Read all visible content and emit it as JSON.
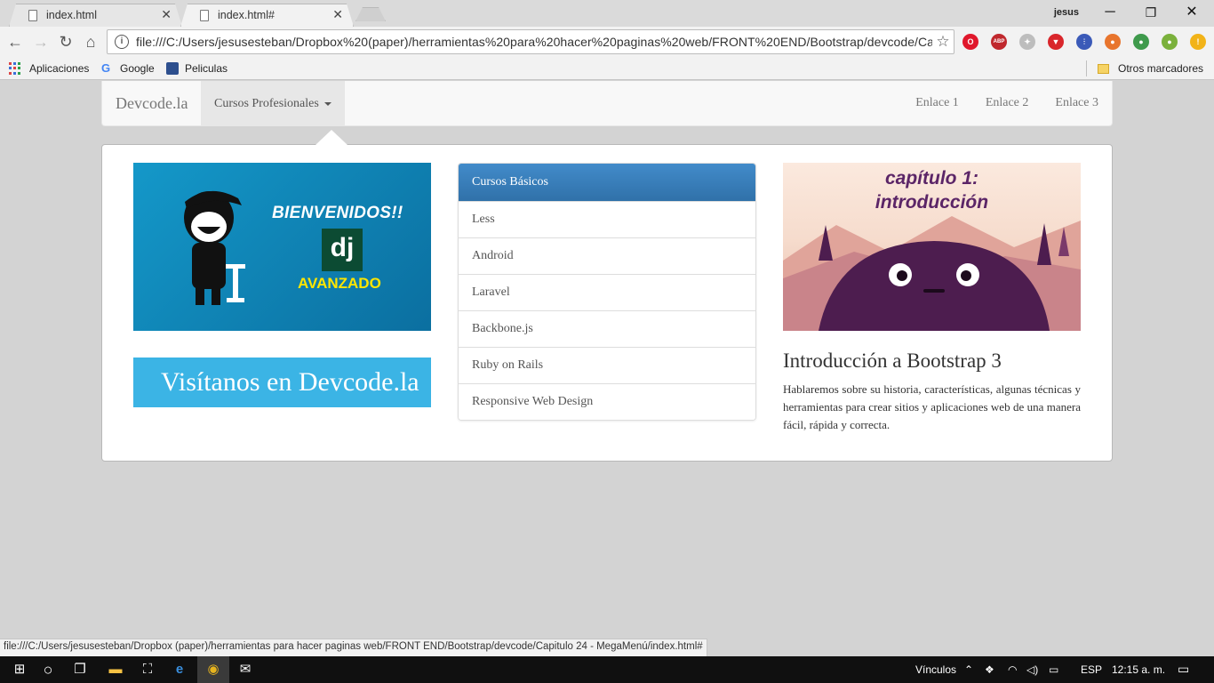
{
  "browser": {
    "tabs": [
      {
        "label": "index.html"
      },
      {
        "label": "index.html#"
      }
    ],
    "close_glyph": "✕",
    "user": "jesus",
    "window_controls": {
      "minimize": "─",
      "maximize": "❐",
      "close": "✕"
    },
    "nav": {
      "back": "←",
      "forward": "→",
      "reload": "↻",
      "home": "⌂"
    },
    "address": "file:///C:/Users/jesusesteban/Dropbox%20(paper)/herramientas%20para%20hacer%20paginas%20web/FRONT%20END/Bootstrap/devcode/Ca...",
    "star": "☆",
    "extensions": [
      {
        "icon": "opera-icon",
        "glyph": "O",
        "color": "#e0172b"
      },
      {
        "icon": "adblock-plus-icon",
        "glyph": "ABP",
        "color": "#c0282d"
      },
      {
        "icon": "puzzle-icon",
        "glyph": "✦",
        "color": "#bdbdbd"
      },
      {
        "icon": "shield-icon",
        "glyph": "▼",
        "color": "#d9262b"
      },
      {
        "icon": "equalizer-icon",
        "glyph": "⫶",
        "color": "#3b5ab8"
      },
      {
        "icon": "firefox-icon",
        "glyph": "●",
        "color": "#e8752d"
      },
      {
        "icon": "globe-icon",
        "glyph": "●",
        "color": "#3f9a4c"
      },
      {
        "icon": "chrome-color-icon",
        "glyph": "●",
        "color": "#7bb13c"
      },
      {
        "icon": "info-icon",
        "glyph": "!",
        "color": "#f2b318"
      }
    ],
    "menu_glyph": "⋮",
    "bookmarks": {
      "apps": "Aplicaciones",
      "google": "Google",
      "movies": "Peliculas",
      "other": "Otros marcadores"
    }
  },
  "page": {
    "brand": "Devcode.la",
    "dropdown_label": "Cursos Profesionales",
    "nav_links": [
      "Enlace 1",
      "Enlace 2",
      "Enlace 3"
    ],
    "banner_left": {
      "heading": "BIENVENIDOS!!",
      "logo": "dj",
      "subheading": "AVANZADO"
    },
    "visit_label": "Visítanos en Devcode.la",
    "courses": {
      "header": "Cursos Básicos",
      "items": [
        "Less",
        "Android",
        "Laravel",
        "Backbone.js",
        "Ruby on Rails",
        "Responsive Web Design"
      ]
    },
    "banner_right": {
      "line1": "capítulo 1:",
      "line2": "introducción"
    },
    "article": {
      "title": "Introducción a Bootstrap 3",
      "body": "Hablaremos sobre su historia, características, algunas técnicas y herramientas para crear sitios y aplicaciones web de una manera fácil, rápida y correcta."
    }
  },
  "status_url": "file:///C:/Users/jesusesteban/Dropbox (paper)/herramientas para hacer paginas web/FRONT END/Bootstrap/devcode/Capitulo 24 - MegaMenú/index.html#",
  "taskbar": {
    "links_label": "Vínculos",
    "language": "ESP",
    "clock": "12:15 a. m."
  },
  "colors": {
    "page_bg": "#d3d3d3",
    "list_header": "#428bca",
    "visit_bg": "#3bb4e5",
    "banner_left_bg": "#1498c9",
    "banner_right_text": "#5b2567"
  }
}
